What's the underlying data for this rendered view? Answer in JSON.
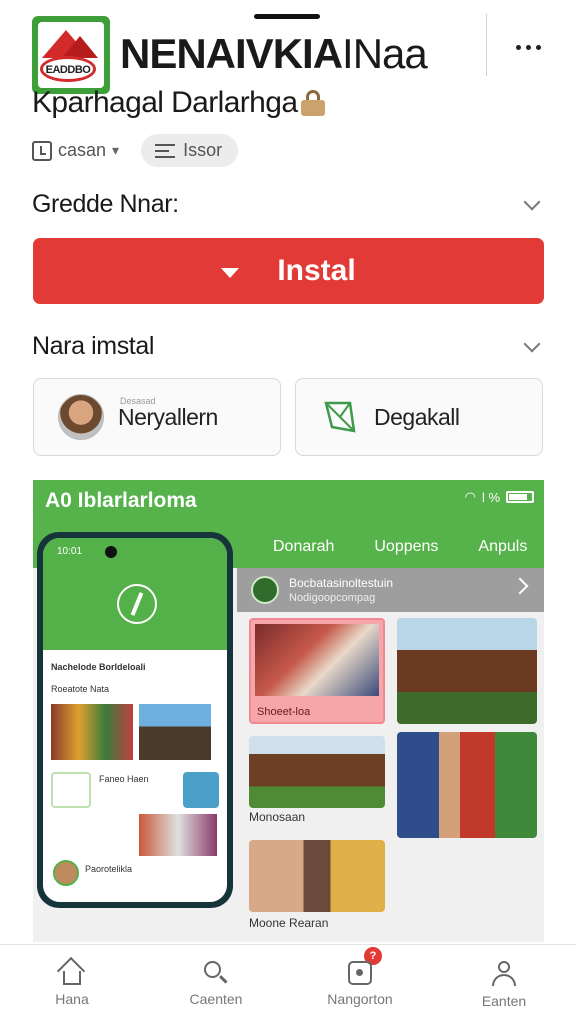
{
  "app": {
    "icon_label": "EADDBO",
    "title_bold": "NENAIVKIA",
    "title_thin": "INaa",
    "developer": "Kparhagal Darlarhga"
  },
  "meta": {
    "time_chip": "casan",
    "tag_chip": "Issor"
  },
  "sections": {
    "first_label": "Gredde Nnar:",
    "install_label": "Instal",
    "second_label": "Nara imstal"
  },
  "cards": {
    "left_small": "Desasad",
    "left_label": "Neryallern",
    "right_label": "Degakall"
  },
  "screens": {
    "band_title": "A0 Iblarlarloma",
    "status_text": "l %",
    "tabs": [
      "Donarah",
      "Uoppens",
      "Anpuls"
    ],
    "subhead_title": "Bocbatasinoltestuin",
    "subhead_sub": "Nodigoopcompag",
    "captions": [
      "Shoeet-loa",
      "Monosaan",
      "Moone Rearan"
    ],
    "phone": {
      "time": "10:01",
      "row1": "Nachelode Borldeloali",
      "row2": "Roeatote Nata",
      "row3": "Faneo Haen",
      "row4": "Paorotelikla"
    }
  },
  "nav": {
    "items": [
      "Hana",
      "Caenten",
      "Nangorton",
      "Eanten"
    ],
    "badge": "?"
  },
  "colors": {
    "install": "#e23a36",
    "brand_green": "#56b24a"
  }
}
